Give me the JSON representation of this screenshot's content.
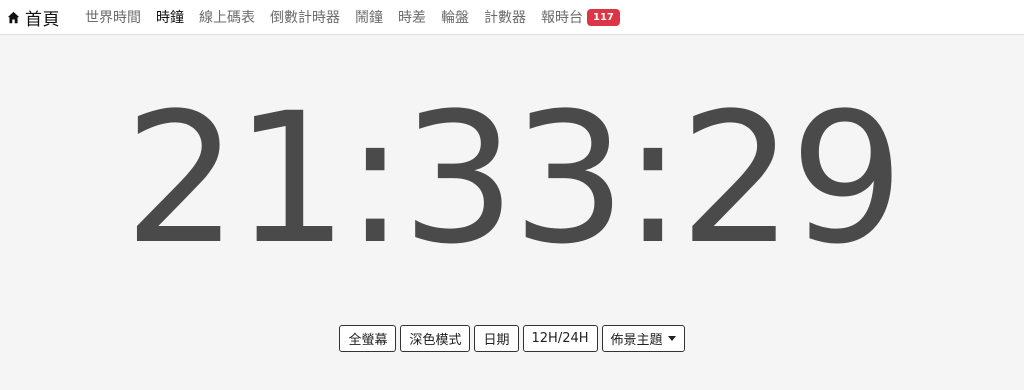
{
  "navbar": {
    "brand_label": "首頁",
    "items": [
      {
        "label": "世界時間"
      },
      {
        "label": "時鐘"
      },
      {
        "label": "線上碼表"
      },
      {
        "label": "倒數計時器"
      },
      {
        "label": "鬧鐘"
      },
      {
        "label": "時差"
      },
      {
        "label": "輪盤"
      },
      {
        "label": "計數器"
      },
      {
        "label": "報時台",
        "badge": "117"
      }
    ],
    "active_index": 1
  },
  "clock": {
    "time": "21:33:29"
  },
  "toolbar": {
    "fullscreen_label": "全螢幕",
    "dark_mode_label": "深色模式",
    "date_label": "日期",
    "hour_format_label": "12H/24H",
    "theme_label": "佈景主題"
  },
  "colors": {
    "badge": "#dc3545",
    "clock_text": "#4a4a4a",
    "background": "#f5f5f5"
  }
}
